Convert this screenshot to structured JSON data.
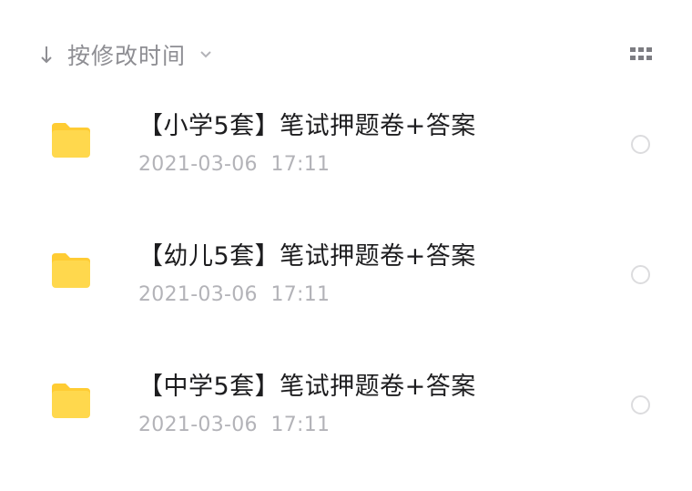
{
  "toolbar": {
    "sort_icon": "arrow-down-icon",
    "sort_label": "按修改时间",
    "sort_dropdown_icon": "chevron-down-icon",
    "view_toggle_icon": "grid-view-icon"
  },
  "files": [
    {
      "icon": "folder-icon",
      "name": "【小学5套】笔试押题卷+答案",
      "modified": "2021-03-06  17:11"
    },
    {
      "icon": "folder-icon",
      "name": "【幼儿5套】笔试押题卷+答案",
      "modified": "2021-03-06  17:11"
    },
    {
      "icon": "folder-icon",
      "name": "【中学5套】笔试押题卷+答案",
      "modified": "2021-03-06  17:11"
    }
  ],
  "colors": {
    "folder": "#FFD84D",
    "folder_tab": "#FFCC33",
    "title_text": "#1d1d1f",
    "secondary_text": "#8e8e93",
    "date_text": "#b3b3b8",
    "radio_border": "#dcdcde"
  }
}
